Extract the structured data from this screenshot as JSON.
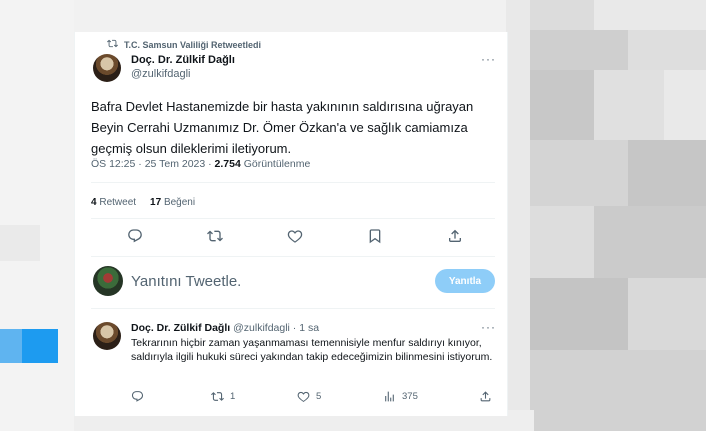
{
  "retweet": {
    "label": "T.C. Samsun Valiliği Retweetledi"
  },
  "tweet": {
    "author_name": "Doç. Dr. Zülkif Dağlı",
    "author_handle": "@zulkifdagli",
    "more": "···",
    "text": "Bafra Devlet Hastanemizde bir hasta yakınının saldırısına uğrayan Beyin Cerrahi Uzmanımız Dr. Ömer Özkan'a ve sağlık camiamıza geçmiş olsun dileklerimi iletiyorum.",
    "time": "ÖS 12:25 · 25 Tem 2023 · ",
    "views": "2.754",
    "views_label": " Görüntülenme",
    "retweet_count": "4",
    "retweet_label": "Retweet",
    "like_count": "17",
    "like_label": "Beğeni"
  },
  "compose": {
    "placeholder": "Yanıtını Tweetle.",
    "button": "Yanıtla"
  },
  "reply": {
    "author_name": "Doç. Dr. Zülkif Dağlı",
    "author_handle": "@zulkifdagli",
    "time": "· 1 sa",
    "more": "···",
    "text": "Tekrarının hiçbir zaman yaşanmaması temennisiyle menfur saldırıyı kınıyor, saldırıyla ilgili hukuki süreci yakından takip edeceğimizin bilinmesini istiyorum.",
    "retweets": "1",
    "likes": "5",
    "views": "375"
  },
  "icons": {
    "retweet": "retweet-icon",
    "reply": "reply-icon",
    "like": "heart-icon",
    "bookmark": "bookmark-icon",
    "share": "share-icon",
    "views": "analytics-icon"
  },
  "colors": {
    "accent": "#1d9bf0",
    "button_disabled": "#8ecdf8",
    "text": "#0f1419",
    "secondary": "#536471"
  }
}
